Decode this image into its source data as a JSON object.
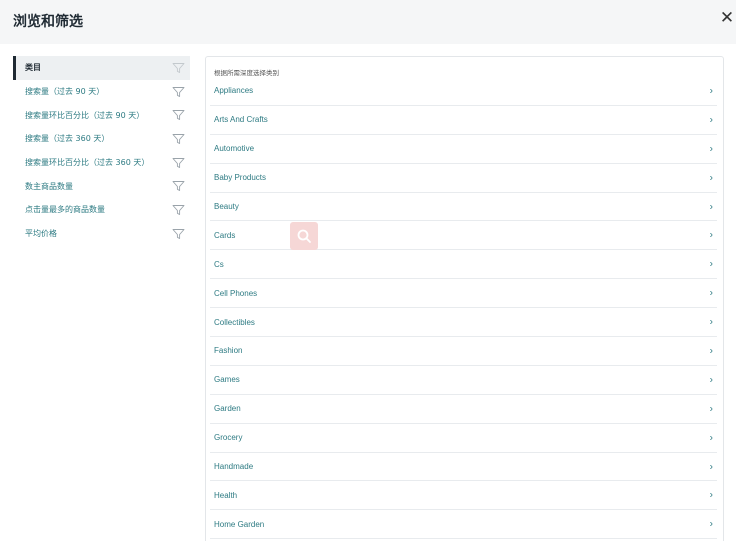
{
  "header": {
    "title": "浏览和筛选"
  },
  "icons": {
    "close": "close-icon",
    "filter": "funnel-icon",
    "chevron": "chevron-right-icon",
    "search": "search-icon"
  },
  "sidebar": {
    "items": [
      {
        "label": "类目",
        "active": true
      },
      {
        "label": "搜索量（过去 90 天）",
        "active": false
      },
      {
        "label": "搜索量环比百分比（过去 90 天）",
        "active": false
      },
      {
        "label": "搜索量（过去 360 天）",
        "active": false
      },
      {
        "label": "搜索量环比百分比（过去 360 天）",
        "active": false
      },
      {
        "label": "数主商品数量",
        "active": false
      },
      {
        "label": "点击量最多的商品数量",
        "active": false
      },
      {
        "label": "平均价格",
        "active": false
      }
    ]
  },
  "panel": {
    "header": "根据所需深度选择类别",
    "categories": [
      "Appliances",
      "Arts And Crafts",
      "Automotive",
      "Baby Products",
      "Beauty",
      "Cards",
      "Cs",
      "Cell Phones",
      "Collectibles",
      "Fashion",
      "Games",
      "Garden",
      "Grocery",
      "Handmade",
      "Health",
      "Home Garden"
    ]
  },
  "colors": {
    "accent": "#2e7b83",
    "header_bg": "#f5f6f7",
    "active_bar": "#1f2a33",
    "search_badge": "#f6d7d6"
  }
}
